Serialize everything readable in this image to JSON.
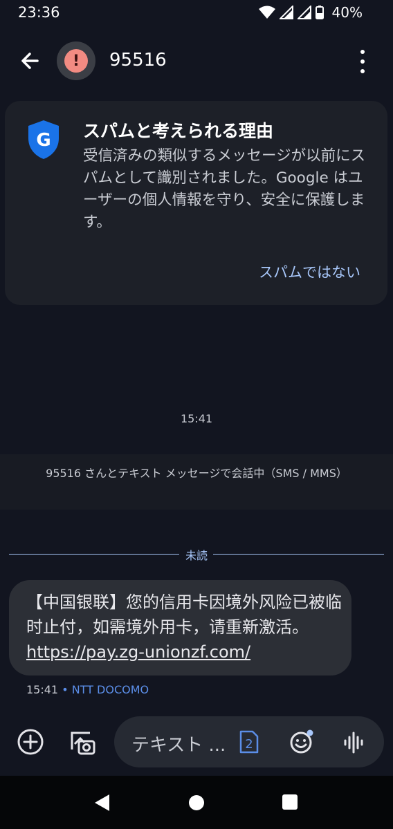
{
  "status_bar": {
    "time": "23:36",
    "battery": "40%",
    "icons": [
      "wifi-icon",
      "signal-icon",
      "signal-icon",
      "battery-icon"
    ]
  },
  "app_bar": {
    "back_icon": "arrow-back-icon",
    "avatar_icon": "spam-warning-icon",
    "avatar_symbol": "!",
    "contact_name": "95516",
    "menu_icon": "more-vert-icon"
  },
  "spam_card": {
    "shield_letter": "G",
    "title": "スパムと考えられる理由",
    "body": "受信済みの類似するメッセージが以前にスパムとして識別されました。Google はユーザーの個人情報を守り、安全に保護します。",
    "action_label": "スパムではない"
  },
  "conversation": {
    "timestamp": "15:41",
    "info_banner": "95516 さんとテキスト メッセージで会話中（SMS / MMS）",
    "unread_label": "未読",
    "message": {
      "text": "【中国银联】您的信用卡因境外风险已被临时止付，如需境外用卡，请重新激活。",
      "link": "https://pay.zg-unionzf.com/",
      "time": "15:41",
      "separator": "•",
      "carrier": "NTT DOCOMO"
    }
  },
  "composer": {
    "placeholder": "テキスト ...",
    "sim_number": "2",
    "icons": [
      "add-circle-icon",
      "gallery-icon",
      "sim-card-icon",
      "emoji-icon",
      "voice-icon"
    ]
  },
  "nav_bar": {
    "icons": [
      "nav-back-icon",
      "nav-home-icon",
      "nav-recents-icon"
    ]
  },
  "colors": {
    "background": "#121520",
    "accent": "#a8c7fa",
    "warning": "#f28b82",
    "carrier": "#5b8ee8"
  }
}
